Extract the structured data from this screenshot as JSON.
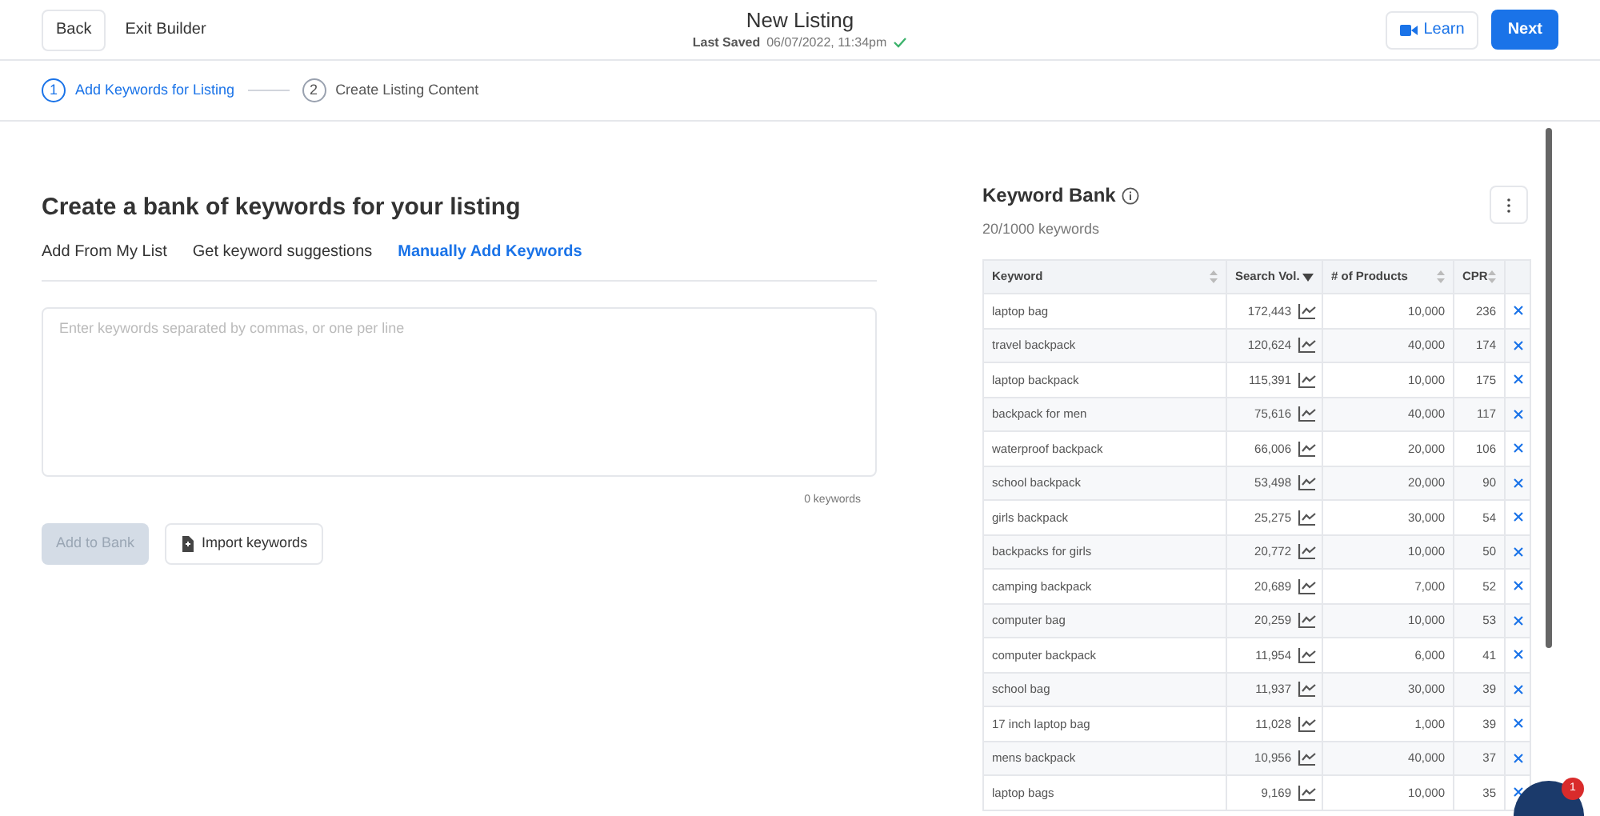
{
  "header": {
    "back": "Back",
    "exit": "Exit Builder",
    "title": "New Listing",
    "saved_label": "Last Saved",
    "saved_time": "06/07/2022, 11:34pm",
    "saved": true,
    "learn": "Learn",
    "next": "Next"
  },
  "steps": [
    {
      "number": "1",
      "label": "Add Keywords for Listing",
      "selected": true
    },
    {
      "number": "2",
      "label": "Create Listing Content",
      "selected": false
    }
  ],
  "builder": {
    "heading": "Create a bank of keywords for your listing",
    "tabs": [
      {
        "label": "Add From My List",
        "selected": false
      },
      {
        "label": "Get keyword suggestions",
        "selected": false
      },
      {
        "label": "Manually Add Keywords",
        "selected": true
      }
    ],
    "input": {
      "placeholder": "Enter keywords separated by commas, or one per line"
    },
    "count": "0 keywords",
    "add_button": {
      "label": "Add to Bank",
      "disabled": true
    },
    "import_button": "Import keywords"
  },
  "bank": {
    "title": "Keyword Bank",
    "subtitle": "20/1000 keywords",
    "columns": [
      {
        "label": "Keyword",
        "sorted": false
      },
      {
        "label": "Search Vol.",
        "sorted": true
      },
      {
        "label": "# of Products",
        "sorted": false
      },
      {
        "label": "CPR",
        "sorted": false
      }
    ],
    "rows": [
      [
        "laptop bag",
        "172,443",
        "10,000",
        "236"
      ],
      [
        "travel backpack",
        "120,624",
        "40,000",
        "174"
      ],
      [
        "laptop backpack",
        "115,391",
        "10,000",
        "175"
      ],
      [
        "backpack for men",
        "75,616",
        "40,000",
        "117"
      ],
      [
        "waterproof backpack",
        "66,006",
        "20,000",
        "106"
      ],
      [
        "school backpack",
        "53,498",
        "20,000",
        "90"
      ],
      [
        "girls backpack",
        "25,275",
        "30,000",
        "54"
      ],
      [
        "backpacks for girls",
        "20,772",
        "10,000",
        "50"
      ],
      [
        "camping backpack",
        "20,689",
        "7,000",
        "52"
      ],
      [
        "computer bag",
        "20,259",
        "10,000",
        "53"
      ],
      [
        "computer backpack",
        "11,954",
        "6,000",
        "41"
      ],
      [
        "school bag",
        "11,937",
        "30,000",
        "39"
      ],
      [
        "17 inch laptop bag",
        "11,028",
        "1,000",
        "39"
      ],
      [
        "mens backpack",
        "10,956",
        "40,000",
        "37"
      ],
      [
        "laptop bags",
        "9,169",
        "10,000",
        "35"
      ]
    ]
  },
  "chat": {
    "badge": "1"
  }
}
